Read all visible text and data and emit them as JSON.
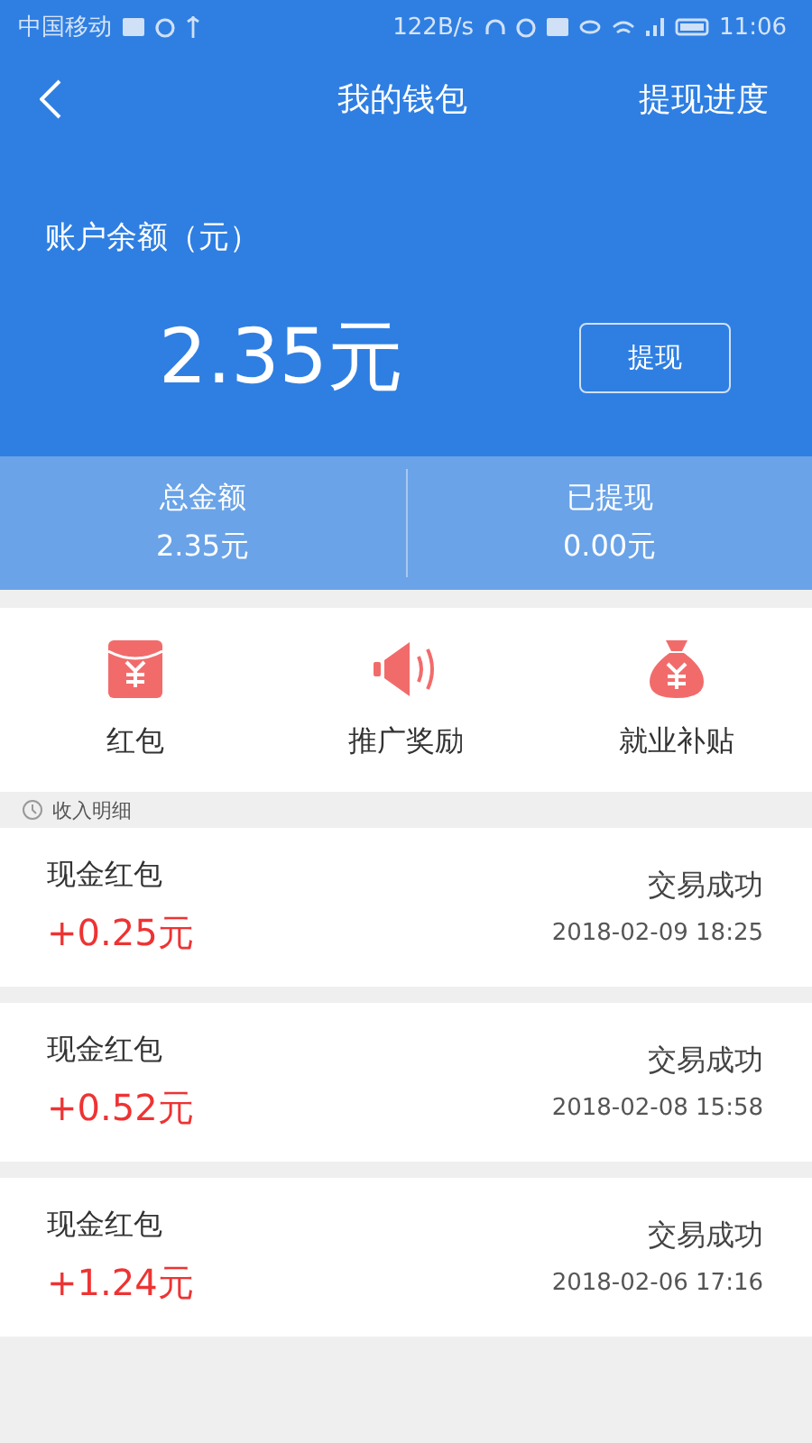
{
  "status_bar": {
    "carrier": "中国移动",
    "speed": "122B/s",
    "time": "11:06"
  },
  "nav": {
    "title": "我的钱包",
    "action": "提现进度"
  },
  "balance": {
    "label": "账户余额（元）",
    "amount": "2.35元",
    "button": "提现"
  },
  "summary": [
    {
      "label": "总金额",
      "value": "2.35元"
    },
    {
      "label": "已提现",
      "value": "0.00元"
    }
  ],
  "shortcuts": [
    {
      "kind": "envelope",
      "label": "红包"
    },
    {
      "kind": "speaker",
      "label": "推广奖励"
    },
    {
      "kind": "moneybag",
      "label": "就业补贴"
    }
  ],
  "records_header": "收入明细",
  "records": [
    {
      "title": "现金红包",
      "amount": "+0.25元",
      "status": "交易成功",
      "time": "2018-02-09 18:25"
    },
    {
      "title": "现金红包",
      "amount": "+0.52元",
      "status": "交易成功",
      "time": "2018-02-08 15:58"
    },
    {
      "title": "现金红包",
      "amount": "+1.24元",
      "status": "交易成功",
      "time": "2018-02-06 17:16"
    }
  ]
}
